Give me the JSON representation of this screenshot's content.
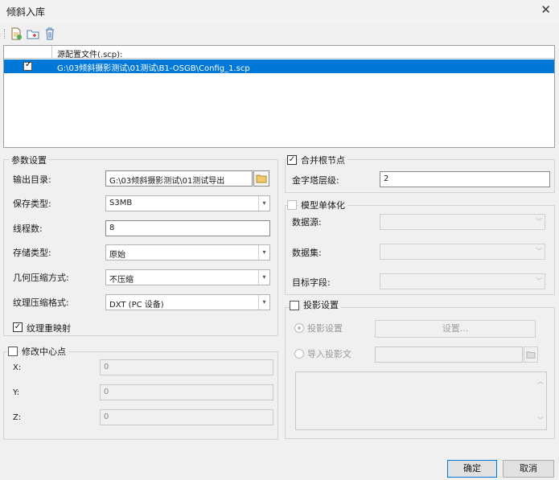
{
  "window": {
    "title": "倾斜入库",
    "close": "✕"
  },
  "toolbar": {
    "icons": [
      "add-file-icon",
      "add-folder-icon",
      "delete-icon"
    ]
  },
  "table": {
    "header": "源配置文件(.scp):",
    "rows": [
      {
        "checked": true,
        "path": "G:\\03倾斜摄影测试\\01测试\\B1-OSGB\\Config_1.scp"
      }
    ]
  },
  "params": {
    "legend": "参数设置",
    "output_dir_label": "输出目录:",
    "output_dir_value": "G:\\03倾斜摄影测试\\01测试导出",
    "save_type_label": "保存类型:",
    "save_type_value": "S3MB",
    "threads_label": "线程数:",
    "threads_value": "8",
    "storage_type_label": "存储类型:",
    "storage_type_value": "原始",
    "geom_compress_label": "几何压缩方式:",
    "geom_compress_value": "不压缩",
    "tex_compress_label": "纹理压缩格式:",
    "tex_compress_value": "DXT (PC 设备)",
    "tex_remap_label": "纹理重映射",
    "tex_remap_checked": "✓"
  },
  "center": {
    "legend": "修改中心点",
    "x_label": "X:",
    "x_value": "0",
    "y_label": "Y:",
    "y_value": "0",
    "z_label": "Z:",
    "z_value": "0"
  },
  "merge": {
    "legend": "合并根节点",
    "checked": "✓",
    "pyramid_label": "金字塔层级:",
    "pyramid_value": "2"
  },
  "mono": {
    "legend": "模型单体化",
    "datasource_label": "数据源:",
    "dataset_label": "数据集:",
    "target_field_label": "目标字段:"
  },
  "projection": {
    "legend": "投影设置",
    "radio_settings_label": "投影设置",
    "settings_button": "设置...",
    "radio_import_label": "导入投影文"
  },
  "footer": {
    "ok": "确定",
    "cancel": "取消"
  }
}
